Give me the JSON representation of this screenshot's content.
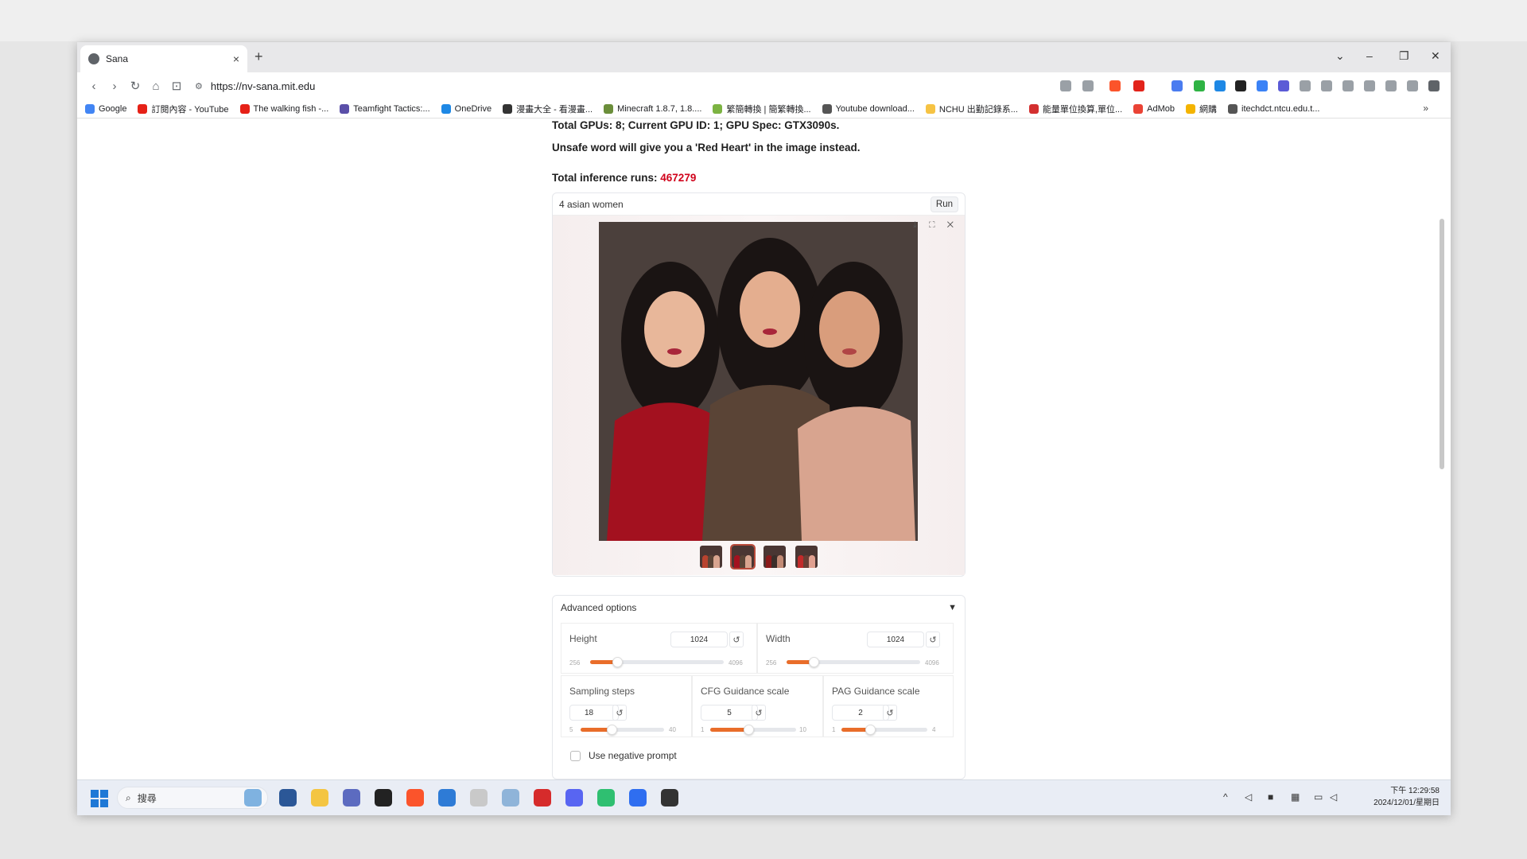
{
  "browser": {
    "tab_title": "Sana",
    "tab_close": "×",
    "new_tab": "+",
    "url": "https://nv-sana.mit.edu",
    "window_controls": {
      "dropdown": "⌄",
      "minimize": "–",
      "restore": "❐",
      "close": "✕"
    }
  },
  "bookmarks": [
    {
      "label": "Google",
      "color": "#4285f4"
    },
    {
      "label": "訂閱內容 - YouTube",
      "color": "#e62117"
    },
    {
      "label": "The walking fish -...",
      "color": "#e62117"
    },
    {
      "label": "Teamfight Tactics:...",
      "color": "#5a4fa8"
    },
    {
      "label": "OneDrive",
      "color": "#1e88e5"
    },
    {
      "label": "漫畫大全 - 看漫畫...",
      "color": "#333333"
    },
    {
      "label": "Minecraft 1.8.7, 1.8....",
      "color": "#6b8e3a"
    },
    {
      "label": "繁簡轉換 | 簡繁轉換...",
      "color": "#7cb342"
    },
    {
      "label": "Youtube download...",
      "color": "#555555"
    },
    {
      "label": "NCHU 出勤記錄系...",
      "color": "#f6c343"
    },
    {
      "label": "能量單位換算,單位...",
      "color": "#d32f2f"
    },
    {
      "label": "AdMob",
      "color": "#ea4335"
    },
    {
      "label": "網購",
      "color": "#f4b400"
    },
    {
      "label": "itechdct.ntcu.edu.t...",
      "color": "#555555"
    }
  ],
  "bookmarks_more": "»",
  "page": {
    "gpu_info": "Total GPUs: 8; Current GPU ID: 1; GPU Spec: GTX3090s.",
    "unsafe_info": "Unsafe word will give you a 'Red Heart' in the image instead.",
    "runs_label": "Total inference runs: ",
    "runs_value": "467279",
    "prompt": "4 asian women",
    "run_label": "Run",
    "gallery_tools": "⤓ ⛶ ✕",
    "advanced": {
      "title": "Advanced options",
      "arrow": "▼",
      "height": {
        "label": "Height",
        "value": "1024",
        "min": "256",
        "max": "4096",
        "fraction": 0.2
      },
      "width": {
        "label": "Width",
        "value": "1024",
        "min": "256",
        "max": "4096",
        "fraction": 0.2
      },
      "steps": {
        "label": "Sampling steps",
        "value": "18",
        "min": "5",
        "max": "40",
        "fraction": 0.37
      },
      "cfg": {
        "label": "CFG Guidance scale",
        "value": "5",
        "min": "1",
        "max": "10",
        "fraction": 0.44
      },
      "pag": {
        "label": "PAG Guidance scale",
        "value": "2",
        "min": "1",
        "max": "4",
        "fraction": 0.33
      },
      "reset_glyph": "↺",
      "negative_prompt": "Use negative prompt"
    }
  },
  "taskbar": {
    "search_placeholder": "搜尋",
    "time": "下午 12:29:58",
    "date": "2024/12/01/星期日"
  }
}
